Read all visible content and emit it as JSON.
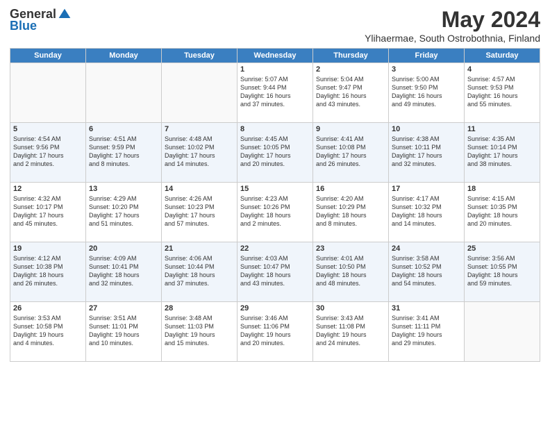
{
  "logo": {
    "general": "General",
    "blue": "Blue"
  },
  "header": {
    "month": "May 2024",
    "location": "Ylihaermae, South Ostrobothnia, Finland"
  },
  "weekdays": [
    "Sunday",
    "Monday",
    "Tuesday",
    "Wednesday",
    "Thursday",
    "Friday",
    "Saturday"
  ],
  "weeks": [
    [
      {
        "day": "",
        "info": ""
      },
      {
        "day": "",
        "info": ""
      },
      {
        "day": "",
        "info": ""
      },
      {
        "day": "1",
        "info": "Sunrise: 5:07 AM\nSunset: 9:44 PM\nDaylight: 16 hours\nand 37 minutes."
      },
      {
        "day": "2",
        "info": "Sunrise: 5:04 AM\nSunset: 9:47 PM\nDaylight: 16 hours\nand 43 minutes."
      },
      {
        "day": "3",
        "info": "Sunrise: 5:00 AM\nSunset: 9:50 PM\nDaylight: 16 hours\nand 49 minutes."
      },
      {
        "day": "4",
        "info": "Sunrise: 4:57 AM\nSunset: 9:53 PM\nDaylight: 16 hours\nand 55 minutes."
      }
    ],
    [
      {
        "day": "5",
        "info": "Sunrise: 4:54 AM\nSunset: 9:56 PM\nDaylight: 17 hours\nand 2 minutes."
      },
      {
        "day": "6",
        "info": "Sunrise: 4:51 AM\nSunset: 9:59 PM\nDaylight: 17 hours\nand 8 minutes."
      },
      {
        "day": "7",
        "info": "Sunrise: 4:48 AM\nSunset: 10:02 PM\nDaylight: 17 hours\nand 14 minutes."
      },
      {
        "day": "8",
        "info": "Sunrise: 4:45 AM\nSunset: 10:05 PM\nDaylight: 17 hours\nand 20 minutes."
      },
      {
        "day": "9",
        "info": "Sunrise: 4:41 AM\nSunset: 10:08 PM\nDaylight: 17 hours\nand 26 minutes."
      },
      {
        "day": "10",
        "info": "Sunrise: 4:38 AM\nSunset: 10:11 PM\nDaylight: 17 hours\nand 32 minutes."
      },
      {
        "day": "11",
        "info": "Sunrise: 4:35 AM\nSunset: 10:14 PM\nDaylight: 17 hours\nand 38 minutes."
      }
    ],
    [
      {
        "day": "12",
        "info": "Sunrise: 4:32 AM\nSunset: 10:17 PM\nDaylight: 17 hours\nand 45 minutes."
      },
      {
        "day": "13",
        "info": "Sunrise: 4:29 AM\nSunset: 10:20 PM\nDaylight: 17 hours\nand 51 minutes."
      },
      {
        "day": "14",
        "info": "Sunrise: 4:26 AM\nSunset: 10:23 PM\nDaylight: 17 hours\nand 57 minutes."
      },
      {
        "day": "15",
        "info": "Sunrise: 4:23 AM\nSunset: 10:26 PM\nDaylight: 18 hours\nand 2 minutes."
      },
      {
        "day": "16",
        "info": "Sunrise: 4:20 AM\nSunset: 10:29 PM\nDaylight: 18 hours\nand 8 minutes."
      },
      {
        "day": "17",
        "info": "Sunrise: 4:17 AM\nSunset: 10:32 PM\nDaylight: 18 hours\nand 14 minutes."
      },
      {
        "day": "18",
        "info": "Sunrise: 4:15 AM\nSunset: 10:35 PM\nDaylight: 18 hours\nand 20 minutes."
      }
    ],
    [
      {
        "day": "19",
        "info": "Sunrise: 4:12 AM\nSunset: 10:38 PM\nDaylight: 18 hours\nand 26 minutes."
      },
      {
        "day": "20",
        "info": "Sunrise: 4:09 AM\nSunset: 10:41 PM\nDaylight: 18 hours\nand 32 minutes."
      },
      {
        "day": "21",
        "info": "Sunrise: 4:06 AM\nSunset: 10:44 PM\nDaylight: 18 hours\nand 37 minutes."
      },
      {
        "day": "22",
        "info": "Sunrise: 4:03 AM\nSunset: 10:47 PM\nDaylight: 18 hours\nand 43 minutes."
      },
      {
        "day": "23",
        "info": "Sunrise: 4:01 AM\nSunset: 10:50 PM\nDaylight: 18 hours\nand 48 minutes."
      },
      {
        "day": "24",
        "info": "Sunrise: 3:58 AM\nSunset: 10:52 PM\nDaylight: 18 hours\nand 54 minutes."
      },
      {
        "day": "25",
        "info": "Sunrise: 3:56 AM\nSunset: 10:55 PM\nDaylight: 18 hours\nand 59 minutes."
      }
    ],
    [
      {
        "day": "26",
        "info": "Sunrise: 3:53 AM\nSunset: 10:58 PM\nDaylight: 19 hours\nand 4 minutes."
      },
      {
        "day": "27",
        "info": "Sunrise: 3:51 AM\nSunset: 11:01 PM\nDaylight: 19 hours\nand 10 minutes."
      },
      {
        "day": "28",
        "info": "Sunrise: 3:48 AM\nSunset: 11:03 PM\nDaylight: 19 hours\nand 15 minutes."
      },
      {
        "day": "29",
        "info": "Sunrise: 3:46 AM\nSunset: 11:06 PM\nDaylight: 19 hours\nand 20 minutes."
      },
      {
        "day": "30",
        "info": "Sunrise: 3:43 AM\nSunset: 11:08 PM\nDaylight: 19 hours\nand 24 minutes."
      },
      {
        "day": "31",
        "info": "Sunrise: 3:41 AM\nSunset: 11:11 PM\nDaylight: 19 hours\nand 29 minutes."
      },
      {
        "day": "",
        "info": ""
      }
    ]
  ]
}
